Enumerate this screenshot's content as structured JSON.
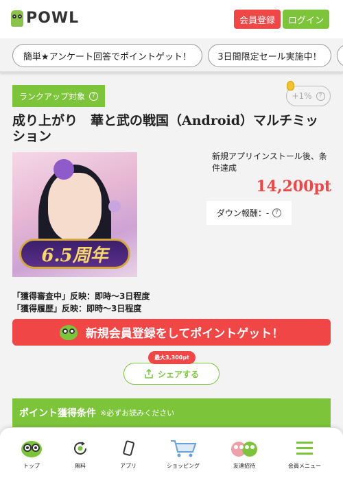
{
  "header": {
    "logo_text": "POWL",
    "register_label": "会員登録",
    "login_label": "ログイン"
  },
  "banners": [
    "簡単★アンケート回答でポイントゲット！",
    "3日間限定セール実施中！"
  ],
  "offer": {
    "rank_badge": "ランクアップ対象",
    "bonus": "+1%",
    "title": "成り上がり　華と武の戦国（Android）マルチミッション",
    "image_text": "6.5周年",
    "condition": "新規アプリインストール後、条件達成",
    "points": "14,200pt",
    "down_reward": "ダウン報酬：-",
    "reflect_review": "「獲得審査中」反映：即時～3日程度",
    "reflect_history": "「獲得履歴」反映：即時～3日程度"
  },
  "cta": {
    "label": "新規会員登録をしてポイントゲット！"
  },
  "share": {
    "tag": "最大3,300pt",
    "label": "シェアする"
  },
  "conditions": {
    "heading": "ポイント獲得条件",
    "note": "※必ずお読みください"
  },
  "nav": [
    {
      "label": "トップ",
      "icon": "owl-icon"
    },
    {
      "label": "無料",
      "icon": "free-icon"
    },
    {
      "label": "アプリ",
      "icon": "phone-icon"
    },
    {
      "label": "ショッピング",
      "icon": "cart-icon"
    },
    {
      "label": "友達招待",
      "icon": "friends-icon"
    },
    {
      "label": "会員メニュー",
      "icon": "menu-icon"
    }
  ],
  "colors": {
    "green": "#7cc53a",
    "red": "#f04646"
  }
}
